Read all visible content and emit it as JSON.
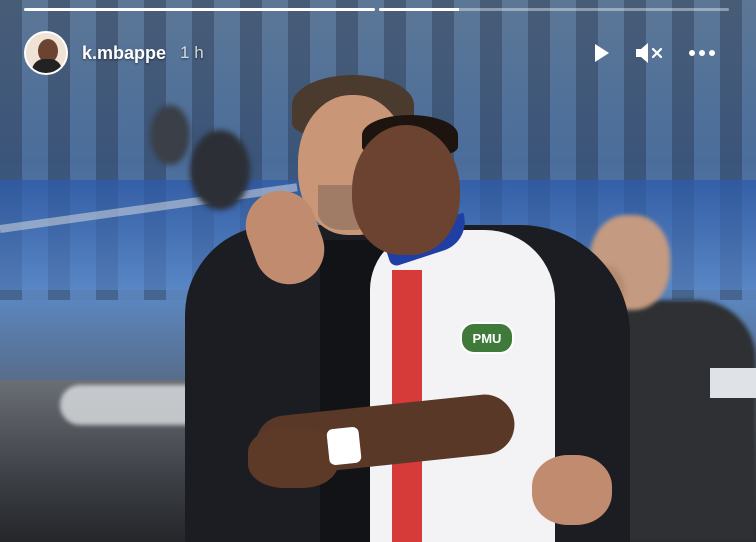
{
  "story": {
    "username": "k.mbappe",
    "timestamp": "1 h",
    "progress": [
      1.0,
      0.23
    ],
    "sponsor_text": "PMU"
  },
  "icons": {
    "play": "play-icon",
    "mute": "mute-icon",
    "more": "more-options-icon"
  }
}
